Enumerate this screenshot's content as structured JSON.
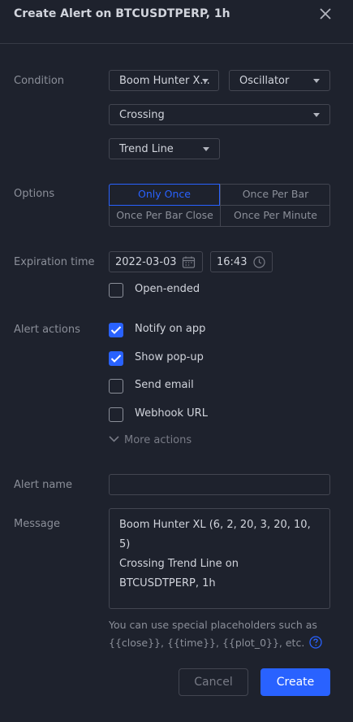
{
  "dialog": {
    "title": "Create Alert on BTCUSDTPERP, 1h"
  },
  "condition": {
    "label": "Condition",
    "indicator": "Boom Hunter X...",
    "plot": "Oscillator",
    "operator": "Crossing",
    "target": "Trend Line"
  },
  "options": {
    "label": "Options",
    "items": [
      "Only Once",
      "Once Per Bar",
      "Once Per Bar Close",
      "Once Per Minute"
    ],
    "selected": "Only Once"
  },
  "expiration": {
    "label": "Expiration time",
    "date": "2022-03-03",
    "time": "16:43",
    "open_ended_label": "Open-ended",
    "open_ended_checked": false
  },
  "alert_actions": {
    "label": "Alert actions",
    "items": [
      {
        "label": "Notify on app",
        "checked": true
      },
      {
        "label": "Show pop-up",
        "checked": true
      },
      {
        "label": "Send email",
        "checked": false
      },
      {
        "label": "Webhook URL",
        "checked": false
      }
    ],
    "more_label": "More actions"
  },
  "alert_name": {
    "label": "Alert name",
    "value": ""
  },
  "message": {
    "label": "Message",
    "line1": "Boom Hunter XL (6, 2, 20, 3, 20, 10, 5)",
    "line2": "Crossing Trend Line on BTCUSDTPERP, 1h",
    "hint_line1": "You can use special placeholders such as",
    "hint_line2": "{{close}}, {{time}}, {{plot_0}}, etc."
  },
  "buttons": {
    "cancel": "Cancel",
    "create": "Create"
  },
  "colors": {
    "background": "#1e222d",
    "accent": "#2962ff",
    "border": "#434651"
  }
}
